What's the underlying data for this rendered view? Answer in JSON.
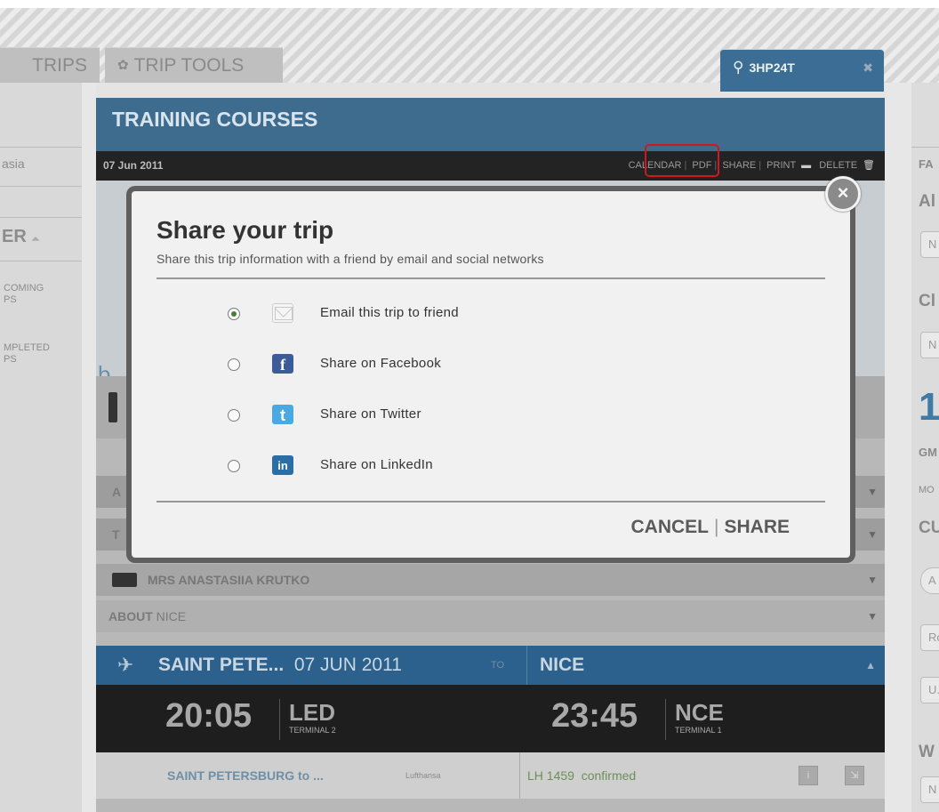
{
  "tabs": {
    "trips": "TRIPS",
    "tools": "TRIP TOOLS",
    "code": "3HP24T"
  },
  "left": {
    "search": "asia",
    "header": "ER",
    "upcoming_1": "COMING",
    "upcoming_2": "PS",
    "completed_1": "MPLETED",
    "completed_2": "PS"
  },
  "right": {
    "t1": "FA",
    "t2": "Al",
    "t3": "Cl",
    "big": "1",
    "gm": "GM",
    "mo": "MO",
    "cu": "CU",
    "r1": "A",
    "r2": "Ro",
    "r3": "U.",
    "w": "W",
    "n": "N"
  },
  "main": {
    "title": "TRAINING COURSES",
    "date": "07 Jun 2011",
    "actions": {
      "calendar": "CALENDAR",
      "pdf": "PDF",
      "share": "SHARE",
      "print": "PRINT",
      "delete": "DELETE"
    },
    "banner_letter": "b",
    "rows": {
      "a_letter": "A",
      "t_letter": "T",
      "traveler": "MRS ANASTASIIA KRUTKO",
      "about_prefix": "ABOUT",
      "about_city": "NICE"
    }
  },
  "flight": {
    "origin": "SAINT PETE...",
    "date": "07 JUN 2011",
    "to_label": "TO",
    "destination": "NICE",
    "dep_time": "20:05",
    "dep_code": "LED",
    "dep_terminal": "TERMINAL 2",
    "arr_time": "23:45",
    "arr_code": "NCE",
    "arr_terminal": "TERMINAL 1",
    "route": "SAINT PETERSBURG to ...",
    "airline": "Lufthansa",
    "flight_no": "LH 1459",
    "status": "confirmed"
  },
  "modal": {
    "title": "Share your trip",
    "subtitle": "Share this trip information with a friend by email and social networks",
    "options": [
      {
        "label": "Email this trip to friend",
        "selected": true,
        "icon": "envelope-icon"
      },
      {
        "label": "Share on Facebook",
        "selected": false,
        "icon": "facebook-icon"
      },
      {
        "label": "Share on Twitter",
        "selected": false,
        "icon": "twitter-icon"
      },
      {
        "label": "Share on LinkedIn",
        "selected": false,
        "icon": "linkedin-icon"
      }
    ],
    "cancel": "CANCEL",
    "share": "SHARE",
    "icon_glyphs": {
      "fb": "f",
      "tw": "t",
      "li": "in"
    }
  },
  "colors": {
    "header_blue": "#3e6c8f",
    "highlight_red": "#d0171f",
    "confirmed_green": "#6c8f57"
  }
}
